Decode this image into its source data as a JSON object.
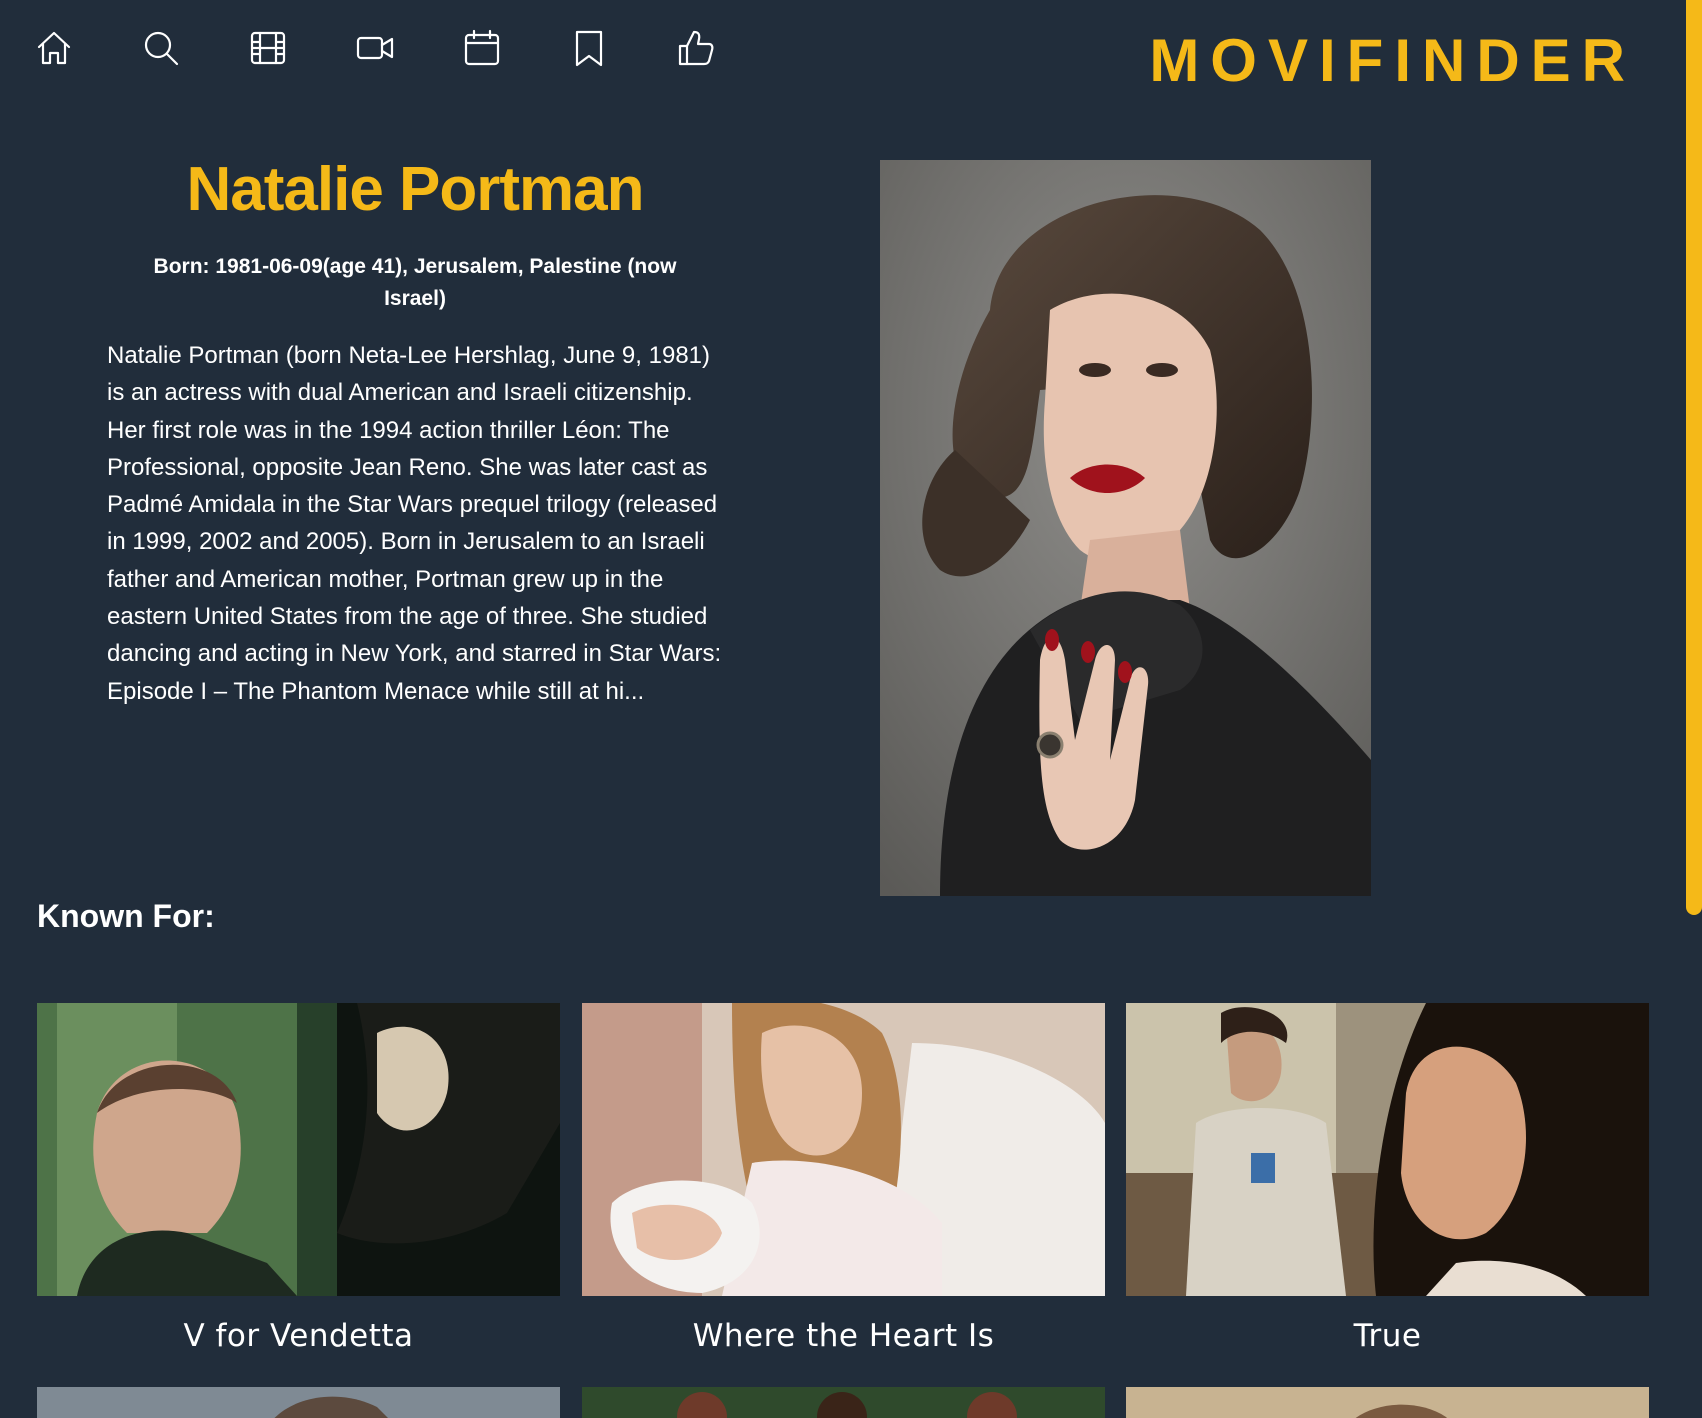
{
  "brand": "MOVIFINDER",
  "nav": [
    {
      "icon": "home-icon"
    },
    {
      "icon": "search-icon"
    },
    {
      "icon": "film-icon"
    },
    {
      "icon": "video-icon"
    },
    {
      "icon": "calendar-icon"
    },
    {
      "icon": "bookmark-icon"
    },
    {
      "icon": "thumbs-up-icon"
    }
  ],
  "person": {
    "name": "Natalie Portman",
    "born": "Born: 1981-06-09(age 41), Jerusalem, Palestine (now Israel)",
    "biography": "Natalie Portman (born Neta-Lee Hershlag, June 9, 1981) is an actress with dual American and Israeli citizenship. Her first role was in the 1994 action thriller Léon: The Professional, opposite Jean Reno. She was later cast as Padmé Amidala in the Star Wars prequel trilogy (released in 1999, 2002 and 2005). Born in Jerusalem to an Israeli father and American mother, Portman grew up in the eastern United States from the age of three. She studied dancing and acting in New York, and starred in Star Wars: Episode I – The Phantom Menace while still at hi..."
  },
  "known_for": {
    "heading": "Known For:",
    "movies": [
      {
        "title": "V for Vendetta"
      },
      {
        "title": "Where the Heart Is"
      },
      {
        "title": "True"
      }
    ]
  },
  "colors": {
    "background": "#212d3b",
    "accent": "#f5b918",
    "text": "#ffffff"
  }
}
